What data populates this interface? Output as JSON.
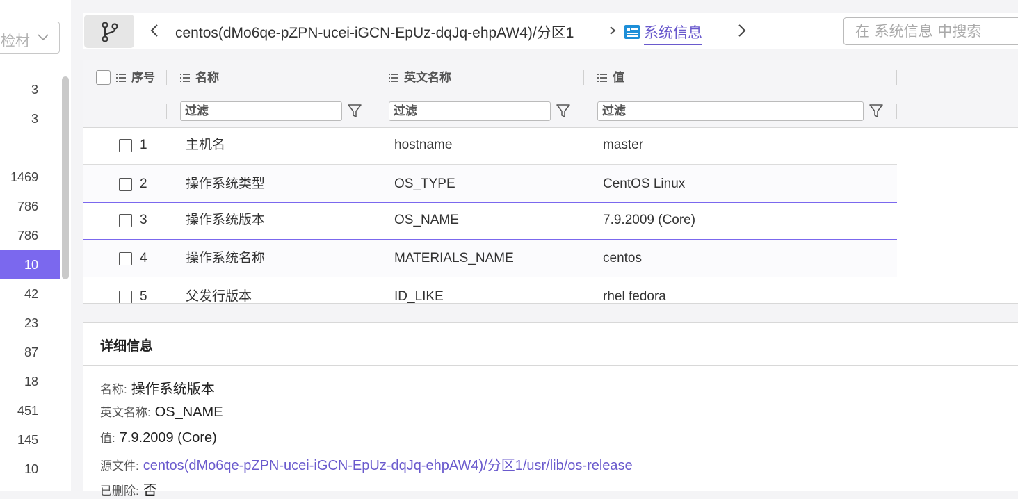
{
  "sidebar": {
    "select_text": "检材",
    "counts": [
      {
        "value": "3",
        "active": false
      },
      {
        "value": "3",
        "active": false
      },
      {
        "value": "",
        "active": false
      },
      {
        "value": "1469",
        "active": false
      },
      {
        "value": "786",
        "active": false
      },
      {
        "value": "786",
        "active": false
      },
      {
        "value": "10",
        "active": true
      },
      {
        "value": "42",
        "active": false
      },
      {
        "value": "23",
        "active": false
      },
      {
        "value": "87",
        "active": false
      },
      {
        "value": "18",
        "active": false
      },
      {
        "value": "451",
        "active": false
      },
      {
        "value": "145",
        "active": false
      },
      {
        "value": "10",
        "active": false
      }
    ]
  },
  "toolbar": {
    "path": "centos(dMo6qe-pZPN-ucei-iGCN-EpUz-dqJq-ehpAW4)/分区1",
    "current": "系统信息",
    "search_placeholder": "在 系统信息 中搜索"
  },
  "table": {
    "columns": {
      "index": "序号",
      "name": "名称",
      "english_name": "英文名称",
      "value": "值"
    },
    "filter_placeholder": "过滤",
    "rows": [
      {
        "index": "1",
        "name": "主机名",
        "english_name": "hostname",
        "value": "master"
      },
      {
        "index": "2",
        "name": "操作系统类型",
        "english_name": "OS_TYPE",
        "value": "CentOS Linux"
      },
      {
        "index": "3",
        "name": "操作系统版本",
        "english_name": "OS_NAME",
        "value": "7.9.2009 (Core)"
      },
      {
        "index": "4",
        "name": "操作系统名称",
        "english_name": "MATERIALS_NAME",
        "value": "centos"
      },
      {
        "index": "5",
        "name": "父发行版本",
        "english_name": "ID_LIKE",
        "value": "rhel fedora"
      }
    ]
  },
  "detail": {
    "title": "详细信息",
    "name_label": "名称:",
    "name_value": "操作系统版本",
    "english_label": "英文名称:",
    "english_value": "OS_NAME",
    "value_label": "值:",
    "value_value": "7.9.2009 (Core)",
    "source_label": "源文件:",
    "source_value": "centos(dMo6qe-pZPN-ucei-iGCN-EpUz-dqJq-ehpAW4)/分区1/usr/lib/os-release",
    "deleted_label": "已删除:",
    "deleted_value": "否"
  },
  "colors": {
    "accent": "#7b68ee",
    "link": "#6a5acd"
  }
}
